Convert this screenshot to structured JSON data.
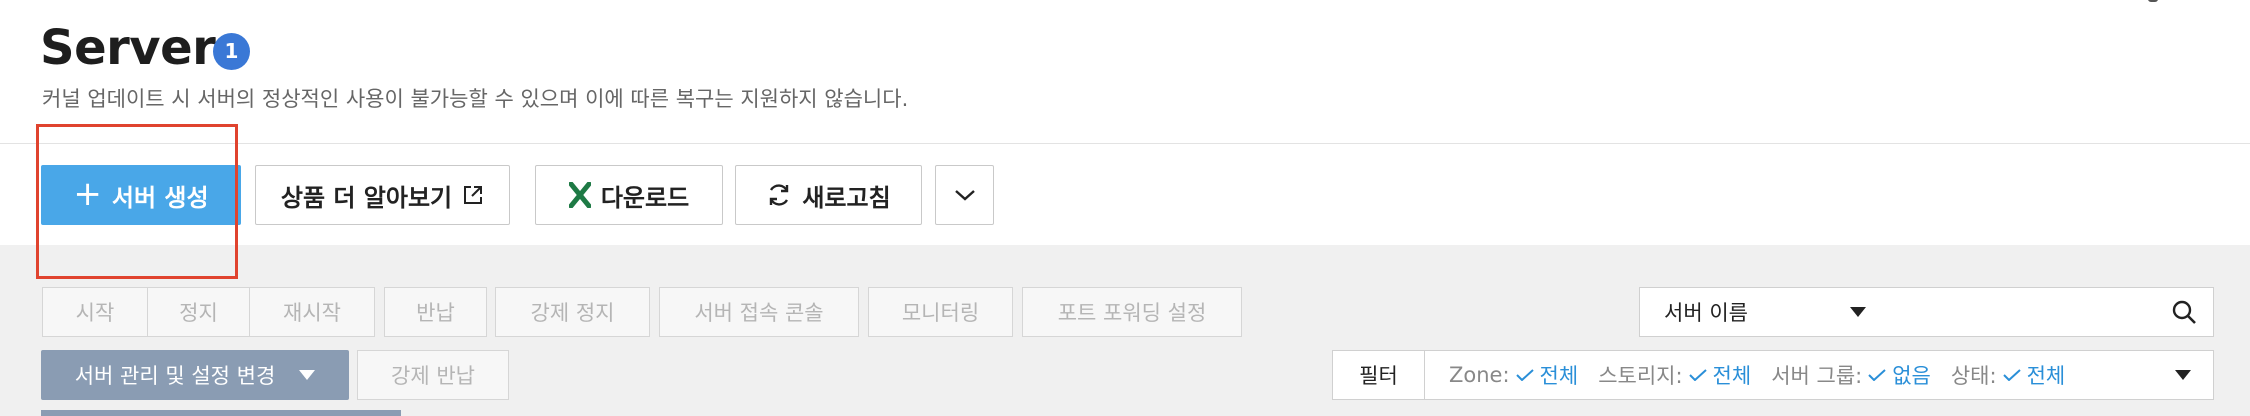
{
  "header": {
    "title": "Server",
    "badge": "1",
    "subtitle": "커널 업데이트 시 서버의 정상적인 사용이 불가능할 수 있으며 이에 따른 복구는 지원하지 않습니다."
  },
  "toolbar": {
    "create_label": "서버 생성",
    "learn_more_label": "상품 더 알아보기",
    "download_label": "다운로드",
    "refresh_label": "새로고침"
  },
  "actions": {
    "start": "시작",
    "stop": "정지",
    "restart": "재시작",
    "return": "반납",
    "force_stop": "강제 정지",
    "console": "서버 접속 콘솔",
    "monitoring": "모니터링",
    "port_forwarding": "포트 포워딩 설정",
    "manage": "서버 관리 및 설정 변경",
    "force_return": "강제 반납"
  },
  "search": {
    "selected": "서버 이름",
    "value": ""
  },
  "filter": {
    "label": "필터",
    "items": [
      {
        "key": "Zone:",
        "value": "전체"
      },
      {
        "key": "스토리지:",
        "value": "전체"
      },
      {
        "key": "서버 그룹:",
        "value": "없음"
      },
      {
        "key": "상태:",
        "value": "전체"
      }
    ]
  },
  "colors": {
    "primary": "#49a7e8",
    "badge": "#3a78d6",
    "highlight": "#e0432e",
    "excel": "#1e7a45",
    "filter_value": "#2a8fd8",
    "manage_button": "#8a9cb3"
  }
}
